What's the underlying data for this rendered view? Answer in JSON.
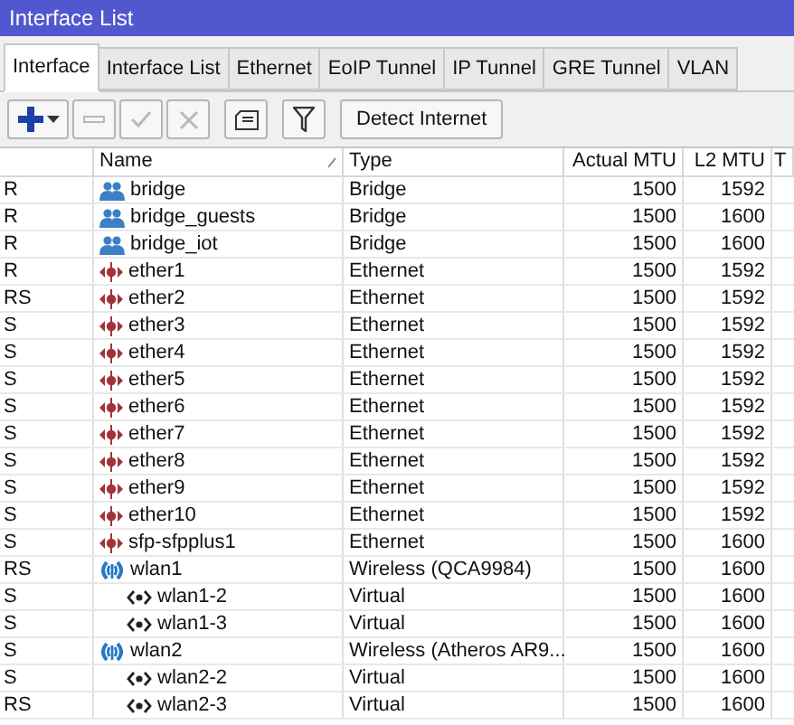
{
  "window": {
    "title": "Interface List"
  },
  "tabs": [
    {
      "label": "Interface",
      "selected": true
    },
    {
      "label": "Interface List",
      "selected": false
    },
    {
      "label": "Ethernet",
      "selected": false
    },
    {
      "label": "EoIP Tunnel",
      "selected": false
    },
    {
      "label": "IP Tunnel",
      "selected": false
    },
    {
      "label": "GRE Tunnel",
      "selected": false
    },
    {
      "label": "VLAN",
      "selected": false
    }
  ],
  "toolbar": [
    {
      "kind": "add",
      "disabled": false
    },
    {
      "kind": "remove",
      "disabled": true
    },
    {
      "kind": "enable",
      "disabled": true
    },
    {
      "kind": "disable",
      "disabled": true
    },
    {
      "kind": "comment",
      "disabled": false
    },
    {
      "kind": "filter",
      "disabled": false
    },
    {
      "kind": "text",
      "label": "Detect Internet",
      "disabled": false
    }
  ],
  "table": {
    "columns": [
      {
        "label": "Name",
        "sorted": true
      },
      {
        "label": "Type",
        "sorted": false
      },
      {
        "label": "Actual MTU",
        "sorted": false
      },
      {
        "label": "L2 MTU",
        "sorted": false
      },
      {
        "label": "T",
        "sorted": false
      }
    ],
    "rows": [
      {
        "flags": "R",
        "kind": "bridge",
        "name": "bridge",
        "type": "Bridge",
        "actual_mtu": "1500",
        "l2_mtu": "1592"
      },
      {
        "flags": "R",
        "kind": "bridge",
        "name": "bridge_guests",
        "type": "Bridge",
        "actual_mtu": "1500",
        "l2_mtu": "1600"
      },
      {
        "flags": "R",
        "kind": "bridge",
        "name": "bridge_iot",
        "type": "Bridge",
        "actual_mtu": "1500",
        "l2_mtu": "1600"
      },
      {
        "flags": "R",
        "kind": "ethernet",
        "name": "ether1",
        "type": "Ethernet",
        "actual_mtu": "1500",
        "l2_mtu": "1592"
      },
      {
        "flags": "RS",
        "kind": "ethernet",
        "name": "ether2",
        "type": "Ethernet",
        "actual_mtu": "1500",
        "l2_mtu": "1592"
      },
      {
        "flags": "S",
        "kind": "ethernet",
        "name": "ether3",
        "type": "Ethernet",
        "actual_mtu": "1500",
        "l2_mtu": "1592"
      },
      {
        "flags": "S",
        "kind": "ethernet",
        "name": "ether4",
        "type": "Ethernet",
        "actual_mtu": "1500",
        "l2_mtu": "1592"
      },
      {
        "flags": "S",
        "kind": "ethernet",
        "name": "ether5",
        "type": "Ethernet",
        "actual_mtu": "1500",
        "l2_mtu": "1592"
      },
      {
        "flags": "S",
        "kind": "ethernet",
        "name": "ether6",
        "type": "Ethernet",
        "actual_mtu": "1500",
        "l2_mtu": "1592"
      },
      {
        "flags": "S",
        "kind": "ethernet",
        "name": "ether7",
        "type": "Ethernet",
        "actual_mtu": "1500",
        "l2_mtu": "1592"
      },
      {
        "flags": "S",
        "kind": "ethernet",
        "name": "ether8",
        "type": "Ethernet",
        "actual_mtu": "1500",
        "l2_mtu": "1592"
      },
      {
        "flags": "S",
        "kind": "ethernet",
        "name": "ether9",
        "type": "Ethernet",
        "actual_mtu": "1500",
        "l2_mtu": "1592"
      },
      {
        "flags": "S",
        "kind": "ethernet",
        "name": "ether10",
        "type": "Ethernet",
        "actual_mtu": "1500",
        "l2_mtu": "1592"
      },
      {
        "flags": "S",
        "kind": "ethernet",
        "name": "sfp-sfpplus1",
        "type": "Ethernet",
        "actual_mtu": "1500",
        "l2_mtu": "1600"
      },
      {
        "flags": "RS",
        "kind": "wireless",
        "name": "wlan1",
        "type": "Wireless (QCA9984)",
        "actual_mtu": "1500",
        "l2_mtu": "1600",
        "children": [
          {
            "flags": "S",
            "kind": "virtual",
            "name": "wlan1-2",
            "type": "Virtual",
            "actual_mtu": "1500",
            "l2_mtu": "1600"
          },
          {
            "flags": "S",
            "kind": "virtual",
            "name": "wlan1-3",
            "type": "Virtual",
            "actual_mtu": "1500",
            "l2_mtu": "1600"
          }
        ]
      },
      {
        "flags": "S",
        "kind": "wireless",
        "name": "wlan2",
        "type": "Wireless (Atheros AR9...",
        "actual_mtu": "1500",
        "l2_mtu": "1600",
        "children": [
          {
            "flags": "S",
            "kind": "virtual",
            "name": "wlan2-2",
            "type": "Virtual",
            "actual_mtu": "1500",
            "l2_mtu": "1600"
          },
          {
            "flags": "RS",
            "kind": "virtual",
            "name": "wlan2-3",
            "type": "Virtual",
            "actual_mtu": "1500",
            "l2_mtu": "1600"
          }
        ]
      }
    ]
  }
}
